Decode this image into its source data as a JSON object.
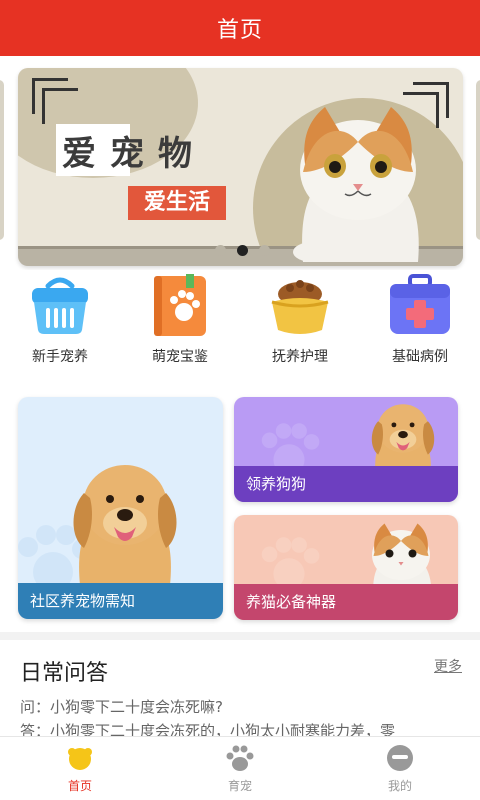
{
  "header": {
    "title": "首页"
  },
  "banner": {
    "title": "爱宠物",
    "subtitle": "爱生活",
    "page_count": 3,
    "active_index": 1
  },
  "quick_entries": [
    {
      "label": "新手宠养",
      "icon": "pet-carrier-icon",
      "color": "#3aa8f0"
    },
    {
      "label": "萌宠宝鉴",
      "icon": "paw-book-icon",
      "color": "#f58a3c"
    },
    {
      "label": "抚养护理",
      "icon": "food-bowl-icon",
      "color": "#f2c443"
    },
    {
      "label": "基础病例",
      "icon": "medical-kit-icon",
      "color": "#6c74f5"
    }
  ],
  "cards": {
    "big": {
      "label": "社区养宠物需知"
    },
    "dog": {
      "label": "领养狗狗"
    },
    "cat": {
      "label": "养猫必备神器"
    }
  },
  "qa": {
    "title": "日常问答",
    "more": "更多",
    "question": "问：小狗零下二十度会冻死嘛?",
    "answer": "答：小狗零下二十度会冻死的，小狗太小耐寒能力差，零"
  },
  "tabbar": {
    "items": [
      {
        "label": "首页",
        "icon": "home-icon",
        "active": true
      },
      {
        "label": "育宠",
        "icon": "paw-icon",
        "active": false
      },
      {
        "label": "我的",
        "icon": "profile-icon",
        "active": false
      }
    ]
  },
  "colors": {
    "primary": "#e63223"
  }
}
